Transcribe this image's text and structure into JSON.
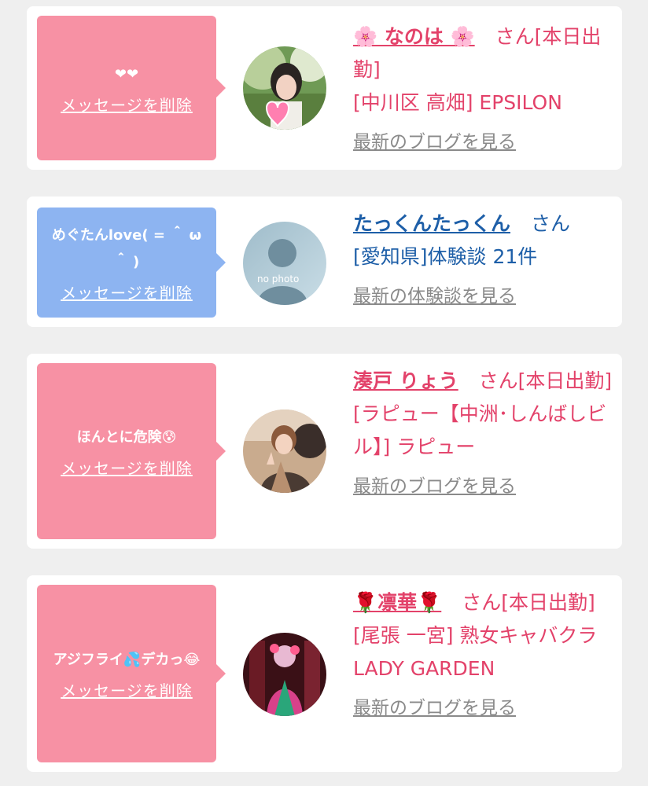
{
  "messages": [
    {
      "bubble_text": "❤❤",
      "delete_label": "メッセージを削除",
      "name": "🌸 なのは 🌸",
      "honorific": "さん[本日出勤]",
      "location": "[中川区 高畑] EPSILON",
      "link_label": "最新のブログを見る",
      "bubble_color": "#f791a4"
    },
    {
      "bubble_text": "めぐたんlove( = ＾ ω ＾ )",
      "delete_label": "メッセージを削除",
      "name": "たっくんたっくん",
      "honorific": "さん",
      "location": "[愛知県]体験談 21件",
      "link_label": "最新の体験談を見る",
      "avatar_text": "no photo",
      "bubble_color": "#8db4f1"
    },
    {
      "bubble_text": "ほんとに危険😰",
      "delete_label": "メッセージを削除",
      "name": "湊戸 りょう",
      "honorific": "さん[本日出勤]",
      "location": "[ラピュー【中洲･しんばしビル】] ラピュー",
      "link_label": "最新のブログを見る",
      "bubble_color": "#f791a4"
    },
    {
      "bubble_text": "アジフライ💦デカっ😂",
      "delete_label": "メッセージを削除",
      "name": "🌹凛華🌹",
      "honorific": "さん[本日出勤]",
      "location": "[尾張 一宮] 熟女キャバクラ LADY GARDEN",
      "link_label": "最新のブログを見る",
      "bubble_color": "#f791a4"
    }
  ],
  "colors": {
    "background": "#efefef",
    "pink_text": "#e3426a",
    "blue_text": "#1e5fa8",
    "link_gray": "#8a8a8a"
  }
}
